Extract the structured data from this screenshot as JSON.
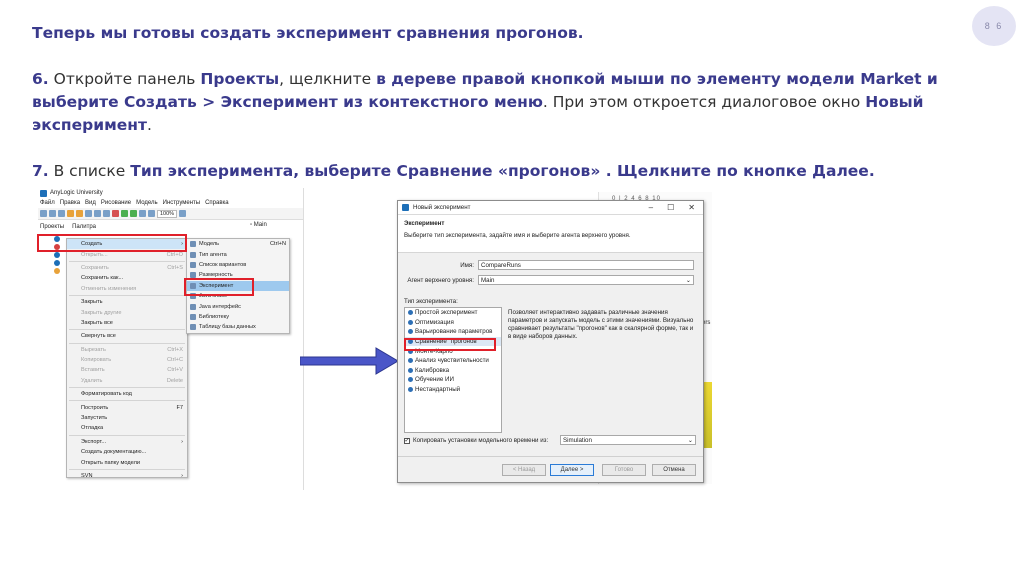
{
  "slide": {
    "page_number": "8 6",
    "heading": "Теперь мы готовы создать эксперимент сравнения прогонов.",
    "step6": {
      "num": "6.",
      "t1": " Откройте панель ",
      "b1": "Проекты",
      "t2": ", щелкните ",
      "b2": "в дереве правой кнопкой мыши по элементу модели Market и выберите Создать > Эксперимент из контекстного меню",
      "t3": ". При этом откроется диалоговое окно ",
      "b3": "Новый эксперимент",
      "t4": "."
    },
    "step7": {
      "num": "7.",
      "t1": " В списке ",
      "b1": "Тип эксперимента, выберите Сравнение «прогонов» . Щелкните по кнопке Далее."
    }
  },
  "left_screenshot": {
    "app_title": "AnyLogic University",
    "menu": [
      "Файл",
      "Правка",
      "Вид",
      "Рисование",
      "Модель",
      "Инструменты",
      "Справка"
    ],
    "zoom": "100%",
    "tabs": [
      "Проекты",
      "Палитра"
    ],
    "main_tab": "Main",
    "context_menu": [
      {
        "label": "Создать",
        "shortcut": "›",
        "state": "sel"
      },
      {
        "label": "Открыть...",
        "shortcut": "Ctrl+O",
        "state": "dis"
      },
      {
        "label": "sep"
      },
      {
        "label": "Сохранить",
        "shortcut": "Ctrl+S",
        "state": "dis"
      },
      {
        "label": "Сохранить как...",
        "shortcut": "",
        "state": ""
      },
      {
        "label": "Отменить изменения",
        "shortcut": "",
        "state": "dis"
      },
      {
        "label": "sep"
      },
      {
        "label": "Закрыть",
        "shortcut": "",
        "state": ""
      },
      {
        "label": "Закрыть другие",
        "shortcut": "",
        "state": "dis"
      },
      {
        "label": "Закрыть все",
        "shortcut": "",
        "state": ""
      },
      {
        "label": "sep"
      },
      {
        "label": "Свернуть все",
        "shortcut": "",
        "state": ""
      },
      {
        "label": "sep"
      },
      {
        "label": "Вырезать",
        "shortcut": "Ctrl+X",
        "state": "dis"
      },
      {
        "label": "Копировать",
        "shortcut": "Ctrl+C",
        "state": "dis"
      },
      {
        "label": "Вставить",
        "shortcut": "Ctrl+V",
        "state": "dis"
      },
      {
        "label": "Удалить",
        "shortcut": "Delete",
        "state": "dis"
      },
      {
        "label": "sep"
      },
      {
        "label": "Форматировать код",
        "shortcut": "",
        "state": ""
      },
      {
        "label": "sep"
      },
      {
        "label": "Построить",
        "shortcut": "F7",
        "state": ""
      },
      {
        "label": "Запустить",
        "shortcut": "",
        "state": ""
      },
      {
        "label": "Отладка",
        "shortcut": "",
        "state": ""
      },
      {
        "label": "sep"
      },
      {
        "label": "Экспорт...",
        "shortcut": "›",
        "state": ""
      },
      {
        "label": "Создать документацию...",
        "shortcut": "",
        "state": ""
      },
      {
        "label": "Открыть папку модели",
        "shortcut": "",
        "state": ""
      },
      {
        "label": "sep"
      },
      {
        "label": "SVN",
        "shortcut": "›",
        "state": ""
      }
    ],
    "submenu": [
      {
        "label": "Модель",
        "shortcut": "Ctrl+N",
        "state": ""
      },
      {
        "label": "Тип агента",
        "shortcut": "",
        "state": ""
      },
      {
        "label": "Список вариантов",
        "shortcut": "",
        "state": ""
      },
      {
        "label": "Размерность",
        "shortcut": "",
        "state": ""
      },
      {
        "label": "Эксперимент",
        "shortcut": "",
        "state": "sel"
      },
      {
        "label": "Java класс",
        "shortcut": "",
        "state": ""
      },
      {
        "label": "Java интерфейс",
        "shortcut": "",
        "state": ""
      },
      {
        "label": "Библиотеку",
        "shortcut": "",
        "state": ""
      },
      {
        "label": "Таблицу базы данных",
        "shortcut": "",
        "state": ""
      }
    ]
  },
  "dialog": {
    "window_title": "Новый эксперимент",
    "header_title": "Эксперимент",
    "header_desc": "Выберите тип эксперимента, задайте имя и выберите агента верхнего уровня.",
    "name_label": "Имя:",
    "name_value": "CompareRuns",
    "agent_label": "Агент верхнего уровня:",
    "agent_value": "Main",
    "type_label": "Тип эксперимента:",
    "types": [
      {
        "label": "Простой эксперимент",
        "selected": false
      },
      {
        "label": "Оптимизация",
        "selected": false
      },
      {
        "label": "Варьирование параметров",
        "selected": false
      },
      {
        "label": "Сравнение \"прогонов\"",
        "selected": true
      },
      {
        "label": "Монте-Карло",
        "selected": false
      },
      {
        "label": "Анализ чувствительности",
        "selected": false
      },
      {
        "label": "Калибровка",
        "selected": false
      },
      {
        "label": "Обучение ИИ",
        "selected": false
      },
      {
        "label": "Нестандартный",
        "selected": false
      }
    ],
    "type_description": "Позволяет интерактивно задавать различные значения параметров и запускать модель с этими значениями. Визуально сравнивает результаты \"прогонов\" как в скалярной форме, так и в виде наборов данных.",
    "copy_label": "Копировать установки модельного времени из:",
    "copy_value": "Simulation",
    "buttons": {
      "back": "< Назад",
      "next": "Далее >",
      "finish": "Готово",
      "cancel": "Отмена"
    },
    "window_controls": [
      "–",
      "☐",
      "✕"
    ]
  },
  "background": {
    "ruler": "0 | 2 4 6 8 10",
    "ers_text": "ers"
  }
}
